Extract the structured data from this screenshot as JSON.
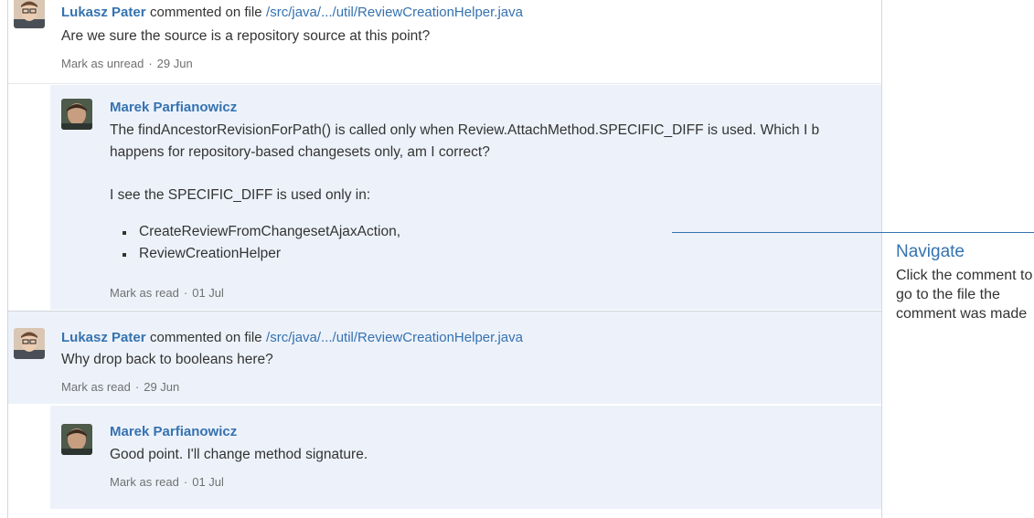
{
  "thread": {
    "c1": {
      "author": "Lukasz Pater",
      "action": "commented on file",
      "file": "/src/java/.../util/ReviewCreationHelper.java",
      "text": "Are we sure the source is a repository source at this point?",
      "mark_label": "Mark as unread",
      "sep": "·",
      "date": "29 Jun"
    },
    "r1": {
      "author": "Marek Parfianowicz",
      "line1": "The findAncestorRevisionForPath() is called only when Review.AttachMethod.SPECIFIC_DIFF is used. Which I b",
      "line2": "happens for repository-based changesets only, am I correct?",
      "line3": "I see the SPECIFIC_DIFF is used only in:",
      "bullets": [
        "CreateReviewFromChangesetAjaxAction,",
        "ReviewCreationHelper"
      ],
      "mark_label": "Mark as read",
      "sep": "·",
      "date": "01 Jul"
    },
    "c2": {
      "author": "Lukasz Pater",
      "action": "commented on file",
      "file": "/src/java/.../util/ReviewCreationHelper.java",
      "text": "Why drop back to booleans here?",
      "mark_label": "Mark as read",
      "sep": "·",
      "date": "29 Jun"
    },
    "r2": {
      "author": "Marek Parfianowicz",
      "text": "Good point. I'll change method signature.",
      "mark_label": "Mark as read",
      "sep": "·",
      "date": "01 Jul"
    }
  },
  "callout": {
    "title": "Navigate",
    "text": "Click the comment to go to the file the comment was made"
  },
  "colors": {
    "link": "#3572b0",
    "unread_bg": "#ffffff",
    "read_bg": "#edf2fa",
    "border": "#d2d6dc"
  }
}
